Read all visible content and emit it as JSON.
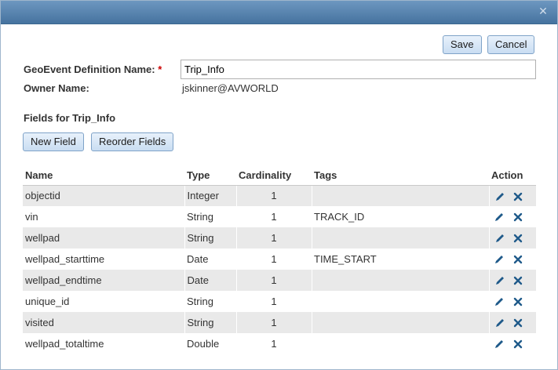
{
  "toolbar": {
    "save_label": "Save",
    "cancel_label": "Cancel"
  },
  "form": {
    "definition_name_label": "GeoEvent Definition Name:",
    "required_marker": "*",
    "definition_name_value": "Trip_Info",
    "owner_label": "Owner Name:",
    "owner_value": "jskinner@AVWORLD"
  },
  "fields_section": {
    "heading": "Fields for Trip_Info",
    "new_field_label": "New Field",
    "reorder_fields_label": "Reorder Fields"
  },
  "table": {
    "headers": {
      "name": "Name",
      "type": "Type",
      "cardinality": "Cardinality",
      "tags": "Tags",
      "action": "Action"
    },
    "rows": [
      {
        "name": "objectid",
        "type": "Integer",
        "cardinality": "1",
        "tags": ""
      },
      {
        "name": "vin",
        "type": "String",
        "cardinality": "1",
        "tags": "TRACK_ID"
      },
      {
        "name": "wellpad",
        "type": "String",
        "cardinality": "1",
        "tags": ""
      },
      {
        "name": "wellpad_starttime",
        "type": "Date",
        "cardinality": "1",
        "tags": "TIME_START"
      },
      {
        "name": "wellpad_endtime",
        "type": "Date",
        "cardinality": "1",
        "tags": ""
      },
      {
        "name": "unique_id",
        "type": "String",
        "cardinality": "1",
        "tags": ""
      },
      {
        "name": "visited",
        "type": "String",
        "cardinality": "1",
        "tags": ""
      },
      {
        "name": "wellpad_totaltime",
        "type": "Double",
        "cardinality": "1",
        "tags": ""
      }
    ]
  },
  "icons": {
    "close": "close-icon",
    "edit": "pencil-icon",
    "delete": "delete-x-icon"
  },
  "colors": {
    "titlebar": "#5682ad",
    "button_fill": "#d6e6f7",
    "row_shade": "#e9e9e9",
    "required": "#cc0000",
    "action_icon": "#1f5a8a"
  }
}
